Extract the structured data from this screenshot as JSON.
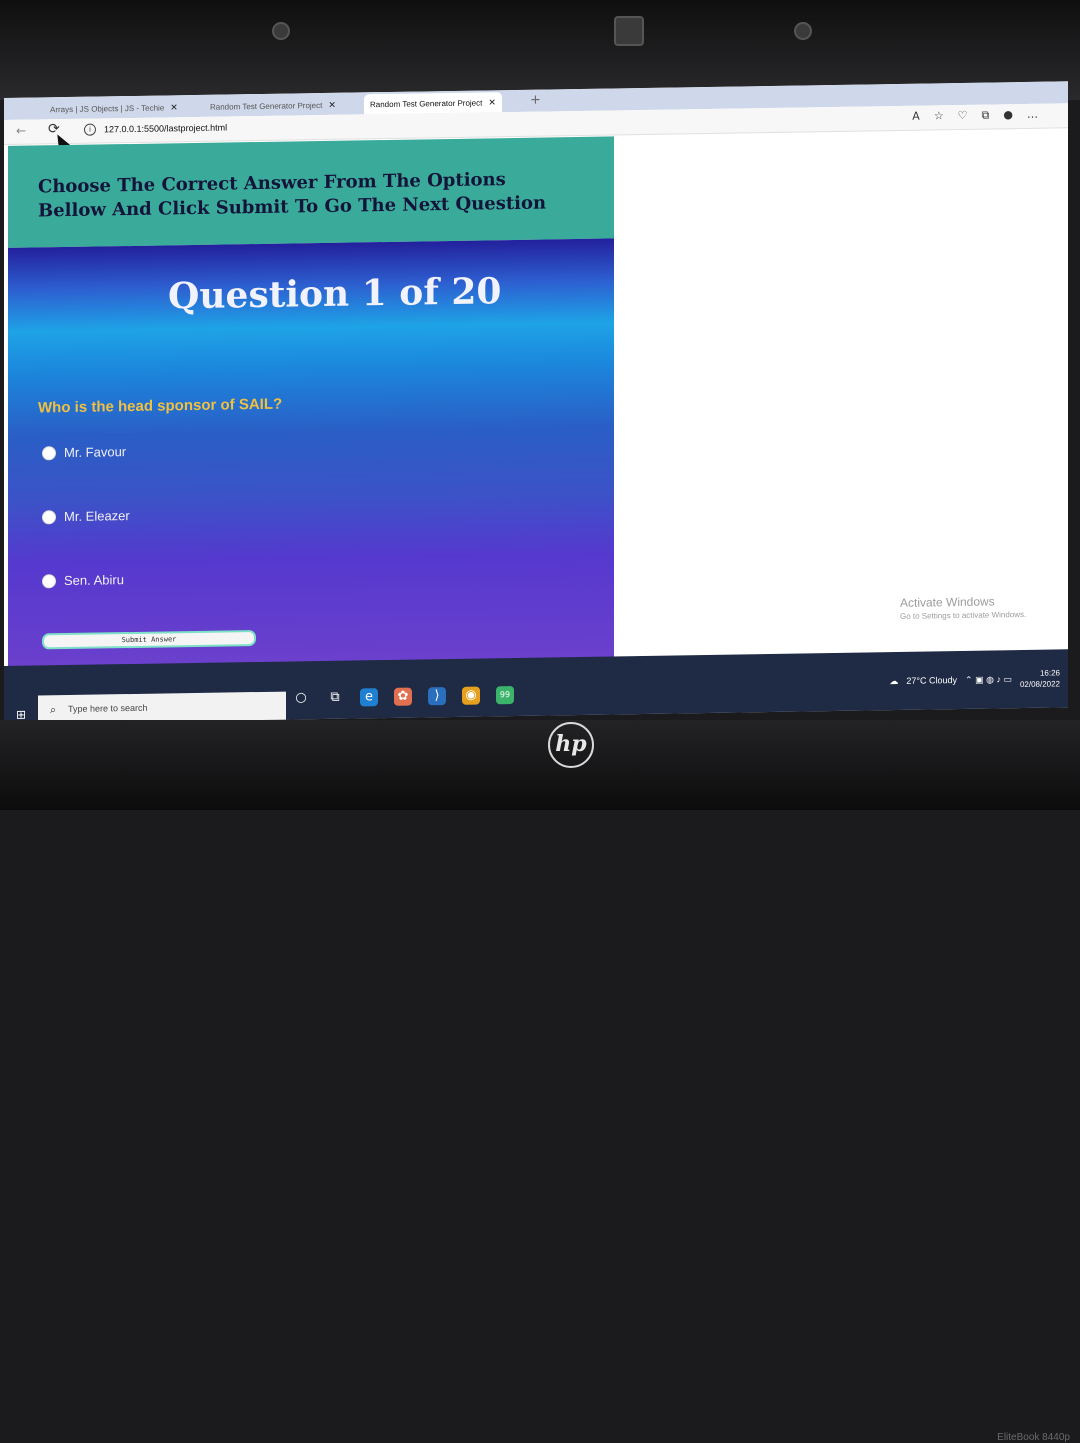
{
  "tabs": [
    {
      "label": "Arrays | JS Objects | JS - Techie"
    },
    {
      "label": "Random Test Generator Project"
    },
    {
      "label": "Random Test Generator Project"
    }
  ],
  "address": {
    "url": "127.0.0.1:5500/lastproject.html"
  },
  "page": {
    "instruction": "Choose The Correct Answer From The Options Bellow And Click Submit To Go The Next Question",
    "question_number": "Question 1 of 20",
    "question": "Who is the head sponsor of SAIL?",
    "options": [
      "Mr. Favour",
      "Mr. Eleazer",
      "Sen. Abiru"
    ],
    "submit_label": "Submit Answer"
  },
  "watermark": {
    "line1": "Activate Windows",
    "line2": "Go to Settings to activate Windows."
  },
  "taskbar": {
    "search_placeholder": "Type here to search",
    "weather": "27°C  Cloudy",
    "time": "16:26",
    "date": "02/08/2022",
    "badge": "99"
  },
  "device": {
    "brand": "hp",
    "model": "EliteBook 8440p"
  },
  "colors": {
    "header_bg": "#3aab9a",
    "question_text": "#f0c040",
    "accent": "#7fe0c8"
  }
}
